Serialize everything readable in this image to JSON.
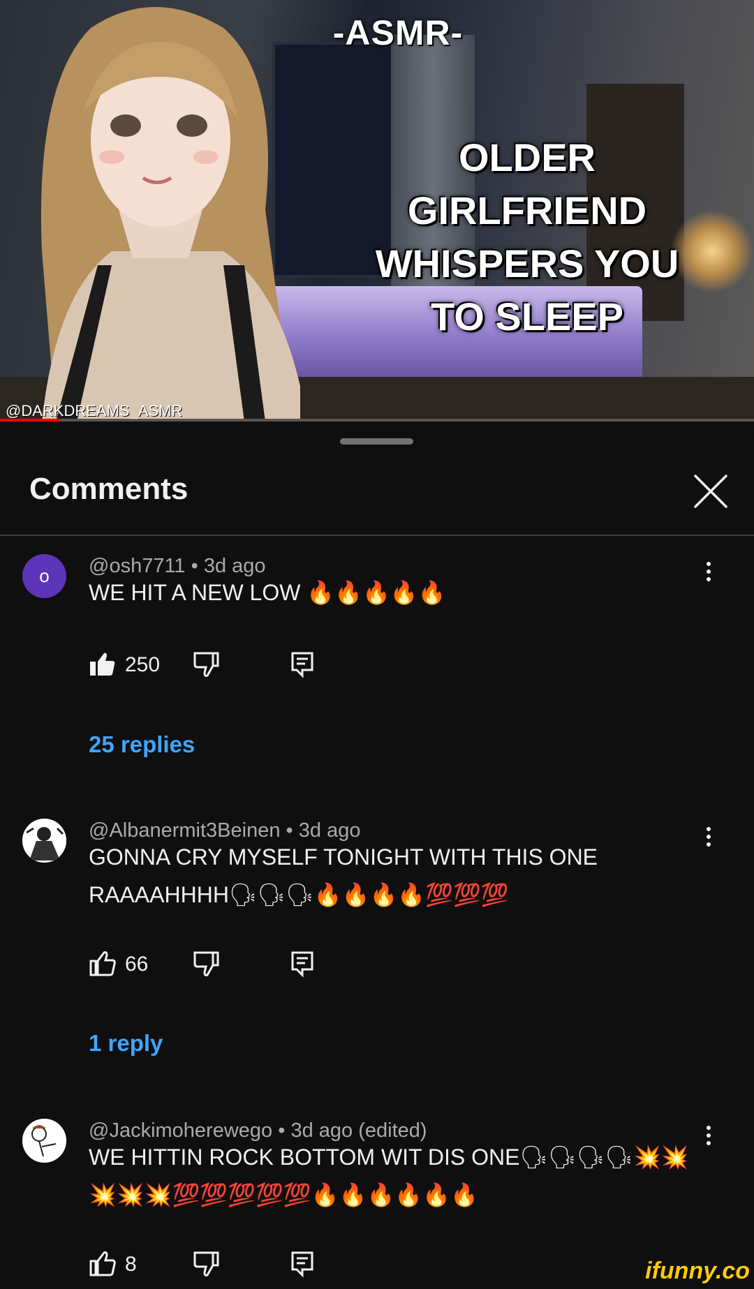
{
  "video": {
    "title_top": "-ASMR-",
    "title_main": "OLDER GIRLFRIEND WHISPERS YOU TO SLEEP",
    "watermark": "@DARKDREAMS_ASMR",
    "progress": 0.08,
    "colors": {
      "progress": "#ff0000"
    }
  },
  "panel": {
    "title": "Comments",
    "close_icon": "close-icon"
  },
  "comments": [
    {
      "avatar_letter": "o",
      "avatar_color": "#5c35b8",
      "author": "@osh7711",
      "time": "3d ago",
      "text": "WE HIT A NEW LOW 🔥🔥🔥🔥🔥",
      "likes": "250",
      "liked": true,
      "replies": "25 replies"
    },
    {
      "author": "@Albanermit3Beinen",
      "time": "3d ago",
      "text": "GONNA CRY MYSELF TONIGHT WITH THIS ONE RAAAAHHHH🗣🗣🗣🔥🔥🔥🔥💯💯💯",
      "likes": "66",
      "liked": false,
      "replies": "1 reply"
    },
    {
      "author": "@Jackimoherewego",
      "time": "3d ago (edited)",
      "text": "WE HITTIN ROCK BOTTOM WIT DIS ONE🗣🗣🗣🗣💥💥💥💥💥💯💯💯💯💯🔥🔥🔥🔥🔥🔥",
      "likes": "8",
      "liked": false
    }
  ],
  "footer": {
    "brand": "ifunny.co"
  }
}
